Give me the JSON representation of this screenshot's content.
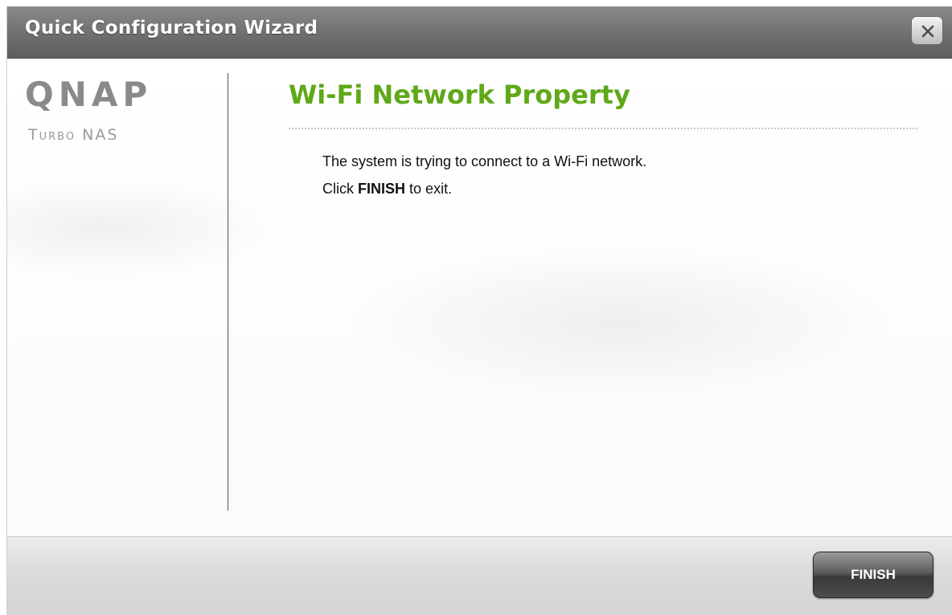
{
  "dialog": {
    "title": "Quick Configuration Wizard",
    "close_label": "X"
  },
  "brand": {
    "name": "QNAP",
    "tagline": "Turbo NAS"
  },
  "content": {
    "heading": "Wi-Fi Network Property",
    "message_line1": "The system is trying to connect to a Wi-Fi network.",
    "message_line2_prefix": "Click",
    "message_line2_bold": "FINISH",
    "message_line2_suffix": "to exit."
  },
  "footer": {
    "finish_label": "FINISH"
  },
  "colors": {
    "heading_green": "#5fa818",
    "titlebar_gray": "#6f6f6f",
    "logo_gray": "#8a8a8a"
  },
  "icons": {
    "close": "close-icon"
  }
}
